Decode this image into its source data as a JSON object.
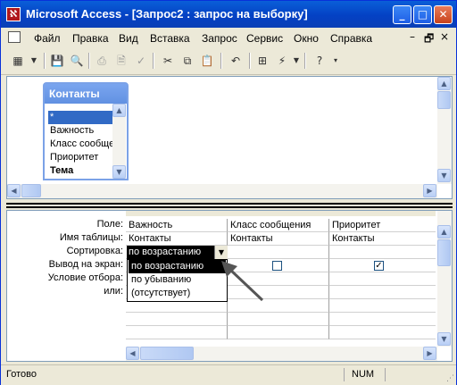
{
  "window": {
    "title": "Microsoft Access - [Запрос2 : запрос на выборку]",
    "app_icon": "access-icon",
    "controls": {
      "minimize": "_",
      "maximize": "□",
      "close": "✕"
    }
  },
  "menubar": {
    "items": [
      "Файл",
      "Правка",
      "Вид",
      "Вставка",
      "Запрос",
      "Сервис",
      "Окно",
      "Справка"
    ],
    "mdi": {
      "minimize": "–",
      "restore": "🗗",
      "close": "×"
    }
  },
  "toolbar": {
    "icons": [
      "datasheet-view-icon",
      "save-icon",
      "search-icon",
      "print-icon",
      "print-preview-icon",
      "spelling-icon",
      "cut-icon",
      "copy-icon",
      "paste-icon",
      "undo-icon",
      "query-type-icon",
      "run-icon",
      "help-icon"
    ]
  },
  "field_list": {
    "title": "Контакты",
    "fields": [
      "*",
      "Важность",
      "Класс сообщения",
      "Приоритет",
      "Тема"
    ],
    "selected_index": 0
  },
  "grid": {
    "row_labels": [
      "Поле:",
      "Имя таблицы:",
      "Сортировка:",
      "Вывод на экран:",
      "Условие отбора:",
      "или:"
    ],
    "columns": [
      {
        "field": "Важность",
        "table": "Контакты",
        "sort": "по возрастанию",
        "show": true
      },
      {
        "field": "Класс сообщения",
        "table": "Контакты",
        "sort": "",
        "show": false
      },
      {
        "field": "Приоритет",
        "table": "Контакты",
        "sort": "",
        "show": true
      }
    ]
  },
  "sort_dropdown": {
    "value": "по возрастанию",
    "options": [
      "по возрастанию",
      "по убыванию",
      "(отсутствует)"
    ],
    "highlighted": 0
  },
  "statusbar": {
    "text": "Готово",
    "num": "NUM"
  }
}
